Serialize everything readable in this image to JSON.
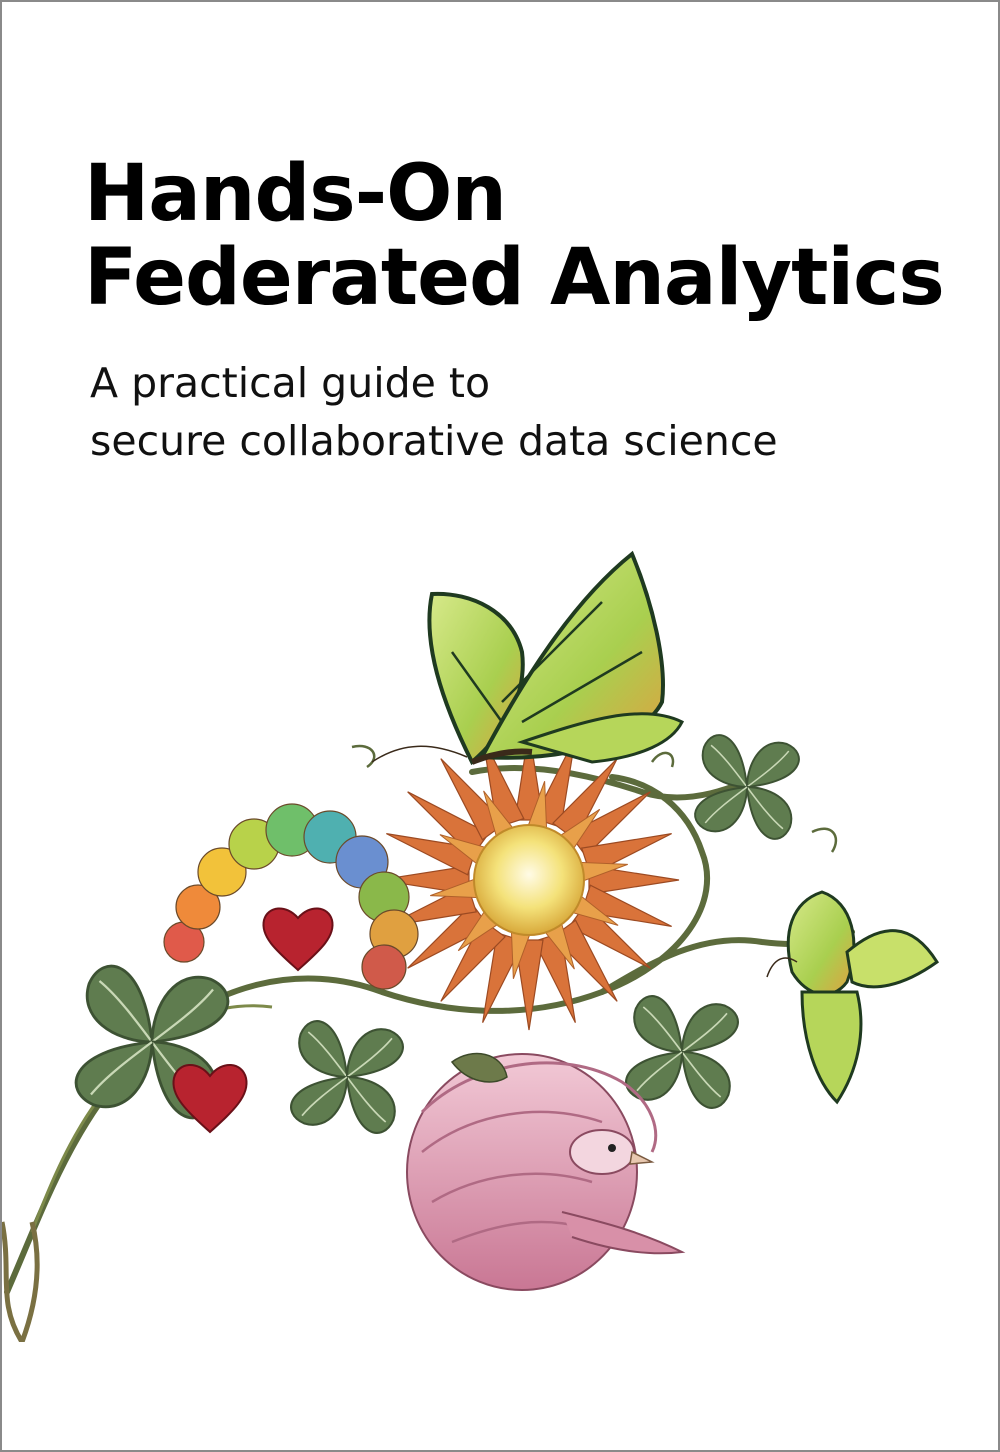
{
  "cover": {
    "title_line1": "Hands-On",
    "title_line2": "Federated Analytics",
    "subtitle_line1": "A practical guide to",
    "subtitle_line2": "secure collaborative data science"
  },
  "illustration": {
    "elements": [
      "butterfly",
      "butterfly",
      "sunflower",
      "caterpillar",
      "bird",
      "heart",
      "heart",
      "clover",
      "clover",
      "clover",
      "clover",
      "vine"
    ]
  },
  "colors": {
    "background": "#ffffff",
    "title": "#000000",
    "border": "#8a8a8a",
    "butterfly_green": "#b6d65a",
    "petal_orange": "#d9733a",
    "heart_red": "#b8232f",
    "clover_green": "#5f7c4f",
    "bird_pink": "#d89aae"
  }
}
